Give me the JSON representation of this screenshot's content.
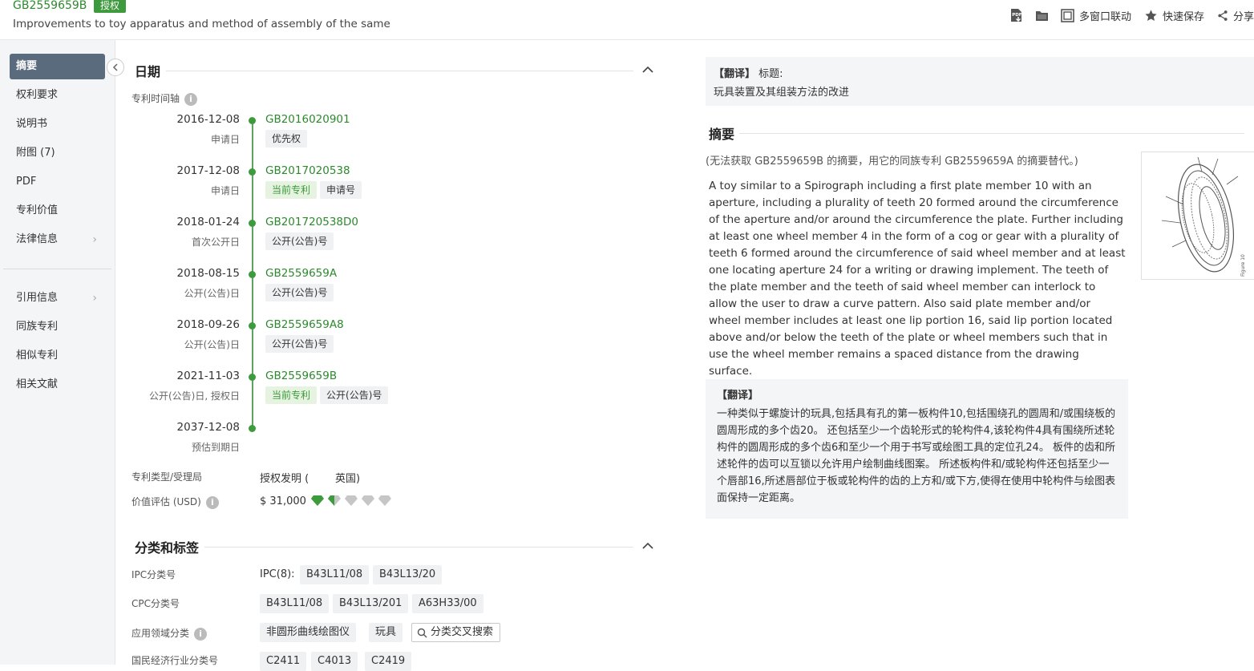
{
  "header": {
    "pub_number": "GB2559659B",
    "status_badge": "授权",
    "title": "Improvements to toy apparatus and method of assembly of the same",
    "toolbar": {
      "multi_window": "多窗口联动",
      "quick_save": "快速保存",
      "share": "分享"
    }
  },
  "nav": {
    "items": [
      {
        "label": "摘要"
      },
      {
        "label": "权利要求"
      },
      {
        "label": "说明书"
      },
      {
        "label": "附图 (7)"
      },
      {
        "label": "PDF"
      },
      {
        "label": "专利价值"
      },
      {
        "label": "法律信息"
      },
      {
        "label": "引用信息"
      },
      {
        "label": "同族专利"
      },
      {
        "label": "相似专利"
      },
      {
        "label": "相关文献"
      }
    ]
  },
  "dates": {
    "section_title": "日期",
    "timeline_label": "专利时间轴",
    "events": [
      {
        "date": "2016-12-08",
        "type": "申请日",
        "number": "GB2016020901",
        "tags": [
          {
            "text": "优先权",
            "green": false
          }
        ]
      },
      {
        "date": "2017-12-08",
        "type": "申请日",
        "number": "GB2017020538",
        "tags": [
          {
            "text": "当前专利",
            "green": true
          },
          {
            "text": "申请号",
            "green": false
          }
        ]
      },
      {
        "date": "2018-01-24",
        "type": "首次公开日",
        "number": "GB201720538D0",
        "tags": [
          {
            "text": "公开(公告)号",
            "green": false
          }
        ]
      },
      {
        "date": "2018-08-15",
        "type": "公开(公告)日",
        "number": "GB2559659A",
        "tags": [
          {
            "text": "公开(公告)号",
            "green": false
          }
        ]
      },
      {
        "date": "2018-09-26",
        "type": "公开(公告)日",
        "number": "GB2559659A8",
        "tags": [
          {
            "text": "公开(公告)号",
            "green": false
          }
        ]
      },
      {
        "date": "2021-11-03",
        "type": "公开(公告)日, 授权日",
        "number": "GB2559659B",
        "tags": [
          {
            "text": "当前专利",
            "green": true
          },
          {
            "text": "公开(公告)号",
            "green": false
          }
        ]
      },
      {
        "date": "2037-12-08",
        "type": "预估到期日",
        "number": "",
        "tags": []
      }
    ],
    "patent_type_label": "专利类型/受理局",
    "patent_type_value": "授权发明 (",
    "patent_office": "英国)",
    "value_label": "价值评估 (USD)",
    "value_amount": "$ 31,000",
    "value_rating": 1.5,
    "value_rating_max": 5
  },
  "classification": {
    "section_title": "分类和标签",
    "ipc_label": "IPC分类号",
    "ipc_prefix": "IPC(8):",
    "ipc_codes": [
      "B43L11/08",
      "B43L13/20"
    ],
    "cpc_label": "CPC分类号",
    "cpc_codes": [
      "B43L11/08",
      "B43L13/201",
      "A63H33/00"
    ],
    "field_label": "应用领域分类",
    "field_tags": [
      "非圆形曲线绘图仪",
      "玩具"
    ],
    "cross_search": "分类交叉搜索",
    "industry_label": "国民经济行业分类号",
    "industry_codes": [
      "C2411",
      "C4013",
      "C2419"
    ]
  },
  "right": {
    "trans_title_hdr": "【翻译】",
    "trans_title_lbl": "标题:",
    "trans_title": "玩具装置及其组装方法的改进",
    "abstract_title": "摘要",
    "abstract_note": "(无法获取 GB2559659B 的摘要，用它的同族专利 GB2559659A 的摘要替代。)",
    "abstract": "A toy similar to a Spirograph including a first plate member 10 with an aperture, including a plurality of teeth 20 formed around the circumference of the aperture and/or around the circumference the plate. Further including at least one wheel member 4 in the form of a cog or gear with a plurality of teeth 6 formed around the circumference of said wheel member and at least one locating aperture 24 for a writing or drawing implement. The teeth of the plate member and the teeth of said wheel member can interlock to allow the user to draw a curve pattern. Also said plate member and/or wheel member includes at least one lip portion 16, said lip portion located above and/or below the teeth of the plate or wheel members such that in use the wheel member remains a spaced distance from the drawing surface.",
    "trans_abs_hdr": "【翻译】",
    "trans_abs": "一种类似于螺旋计的玩具,包括具有孔的第一板构件10,包括围绕孔的圆周和/或围绕板的圆周形成的多个齿20。 还包括至少一个齿轮形式的轮构件4,该轮构件4具有围绕所述轮构件的圆周形成的多个齿6和至少一个用于书写或绘图工具的定位孔24。 板件的齿和所述轮件的齿可以互锁以允许用户绘制曲线图案。 所述板构件和/或轮构件还包括至少一个唇部16,所述唇部位于板或轮构件的齿的上方和/或下方,使得在使用中轮构件与绘图表面保持一定距离。",
    "figure_label": "Figure 10"
  },
  "colors": {
    "brand_green": "#3d9a3d",
    "nav_active": "#5a6b7e"
  }
}
